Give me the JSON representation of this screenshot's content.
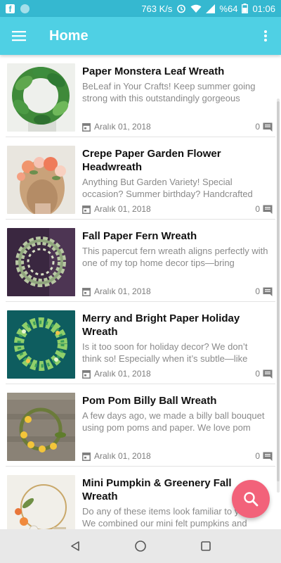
{
  "status_bar": {
    "network_speed": "763 K/s",
    "battery": "%64",
    "time": "01:06"
  },
  "app_bar": {
    "title": "Home",
    "menu_icon": "hamburger-menu-icon",
    "more_icon": "more-vert-icon"
  },
  "colors": {
    "status_bar": "#35b8d0",
    "app_bar": "#4fd0e4",
    "fab": "#f2627a",
    "nav_bar": "#e8e8e8"
  },
  "posts": [
    {
      "title": "Paper Monstera Leaf Wreath",
      "excerpt": "BeLeaf in Your Crafts! Keep summer going strong with this outstandingly gorgeous",
      "date": "Aralık 01, 2018",
      "comments": "0"
    },
    {
      "title": "Crepe Paper Garden Flower Headwreath",
      "excerpt": "Anything But Garden Variety! Special occasion? Summer birthday? Handcrafted",
      "date": "Aralık 01, 2018",
      "comments": "0"
    },
    {
      "title": "Fall Paper Fern Wreath",
      "excerpt": "This papercut fern wreath aligns perfectly with one of my top home decor tips—bring",
      "date": "Aralık 01, 2018",
      "comments": "0"
    },
    {
      "title": "Merry and Bright Paper Holiday Wreath",
      "excerpt": "Is it too soon for holiday decor? We don’t think so! Especially when it’s subtle—like",
      "date": "Aralık 01, 2018",
      "comments": "0"
    },
    {
      "title": "Pom Pom Billy Ball Wreath",
      "excerpt": "A few days ago, we made a billy ball bouquet using pom poms and paper. We love pom",
      "date": "Aralık 01, 2018",
      "comments": "0"
    },
    {
      "title": "Mini Pumpkin & Greenery Fall Wreath",
      "excerpt": "Do any of these items look familiar to you? We combined our mini felt pumpkins and",
      "date": "",
      "comments": ""
    }
  ],
  "fab": {
    "icon": "search-icon"
  },
  "nav_bar": {
    "back_icon": "back-triangle-icon",
    "home_icon": "home-circle-icon",
    "recents_icon": "recents-square-icon"
  }
}
